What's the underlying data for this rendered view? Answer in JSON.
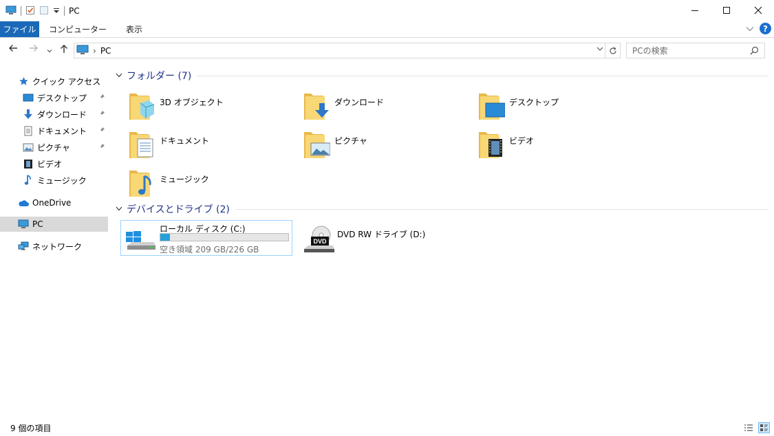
{
  "window": {
    "title": "PC"
  },
  "ribbon": {
    "tabs": [
      "ファイル",
      "コンピューター",
      "表示"
    ]
  },
  "address": {
    "crumbs": [
      "PC"
    ]
  },
  "search": {
    "placeholder": "PCの検索"
  },
  "sidebar": {
    "quick_access": "クイック アクセス",
    "quick_items": [
      "デスクトップ",
      "ダウンロード",
      "ドキュメント",
      "ピクチャ",
      "ビデオ",
      "ミュージック"
    ],
    "onedrive": "OneDrive",
    "pc": "PC",
    "network": "ネットワーク"
  },
  "folders": {
    "header": "フォルダー (7)",
    "items": [
      "3D オブジェクト",
      "ダウンロード",
      "デスクトップ",
      "ドキュメント",
      "ピクチャ",
      "ビデオ",
      "ミュージック"
    ]
  },
  "drives": {
    "header": "デバイスとドライブ (2)",
    "local": {
      "name": "ローカル ディスク (C:)",
      "free": "空き領域 209 GB/226 GB",
      "used_fraction": 0.075
    },
    "dvd": {
      "name": "DVD RW ドライブ (D:)",
      "badge": "DVD"
    }
  },
  "status": {
    "count": "9 個の項目"
  },
  "colors": {
    "accent": "#1a68b8",
    "selected_nav": "#d9d9d9",
    "group_header": "#1e3287",
    "bar_fill": "#26a0da"
  }
}
